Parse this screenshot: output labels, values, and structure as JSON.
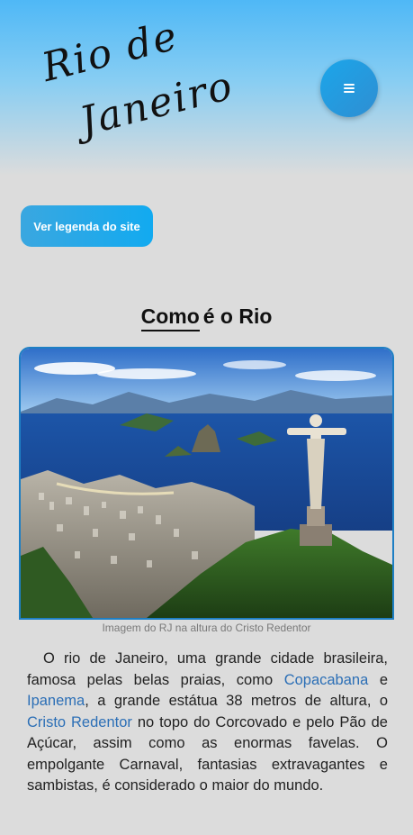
{
  "header": {
    "logo_line1": "Rio de",
    "logo_line2": "Janeiro",
    "menu_icon": "hamburger-icon"
  },
  "legend_button": {
    "label": "Ver legenda do site"
  },
  "section": {
    "title_underlined": "Como",
    "title_rest": "é o Rio"
  },
  "image": {
    "caption": "Imagem do RJ na altura do Cristo Redentor"
  },
  "paragraph": {
    "part1": "O rio de Janeiro, uma grande cidade brasileira, famosa pelas belas praias, como ",
    "link1": "Copacabana",
    "part2": " e ",
    "link2": "Ipanema",
    "part3": ", a grande estátua 38 metros de altura, o ",
    "link3": "Cristo Redentor",
    "part4": " no topo do Corcovado e pelo Pão de Açúcar, assim como as enormas favelas. O empolgante Carnaval, fantasias extravagantes e sambistas, é considerado o maior do mundo."
  },
  "colors": {
    "accent": "#12aaf0",
    "link": "#2c6fb6",
    "background": "#dcdcdc"
  }
}
